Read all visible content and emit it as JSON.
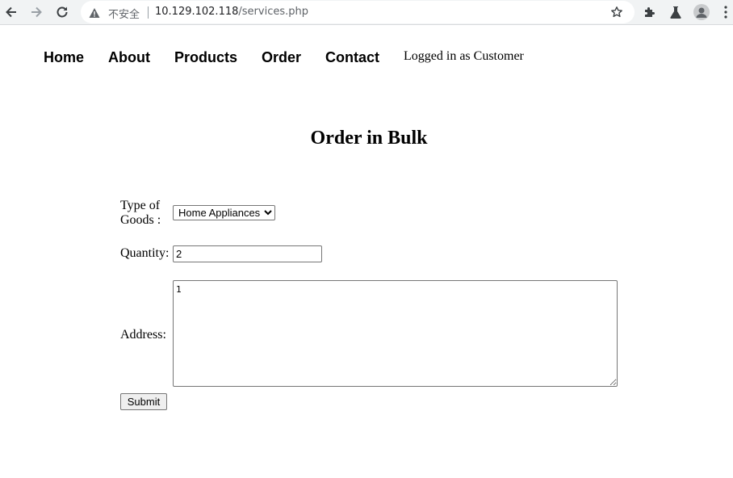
{
  "browser": {
    "security_label": "不安全",
    "url_host": "10.129.102.118",
    "url_path": "/services.php"
  },
  "nav": {
    "items": [
      "Home",
      "About",
      "Products",
      "Order",
      "Contact"
    ],
    "login_status": "Logged in as Customer"
  },
  "page": {
    "title": "Order in Bulk"
  },
  "form": {
    "goods_label": "Type of Goods :",
    "goods_selected": "Home Appliances",
    "quantity_label": "Quantity:",
    "quantity_value": "2",
    "address_label": "Address:",
    "address_value": "1",
    "submit_label": "Submit"
  }
}
